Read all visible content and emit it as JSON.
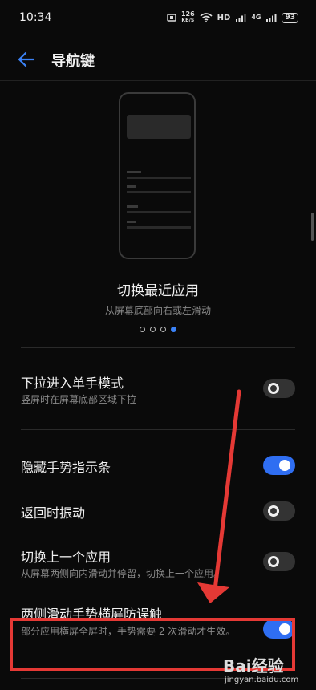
{
  "status_bar": {
    "time": "10:34",
    "network_speed": "126",
    "network_speed_unit": "KB/S",
    "hd_label": "HD",
    "network_gen": "4G",
    "battery": "93"
  },
  "header": {
    "title": "导航键"
  },
  "gesture_preview": {
    "title": "切换最近应用",
    "subtitle": "从屏幕底部向右或左滑动",
    "page_count": 4,
    "active_page": 4
  },
  "settings": [
    {
      "title": "下拉进入单手模式",
      "description": "竖屏时在屏幕底部区域下拉",
      "enabled": false
    },
    {
      "title": "隐藏手势指示条",
      "description": "",
      "enabled": true
    },
    {
      "title": "返回时振动",
      "description": "",
      "enabled": false
    },
    {
      "title": "切换上一个应用",
      "description": "从屏幕两侧向内滑动并停留，切换上一个应用。",
      "enabled": false
    },
    {
      "title": "两侧滑动手势横屏防误触",
      "description": "部分应用横屏全屏时，手势需要 2 次滑动才生效。",
      "enabled": true
    }
  ],
  "watermark": {
    "brand": "Bai经验",
    "url": "jingyan.baidu.com"
  },
  "colors": {
    "accent": "#2f6ef2",
    "annotation": "#e53935",
    "background": "#0a0a0a"
  }
}
